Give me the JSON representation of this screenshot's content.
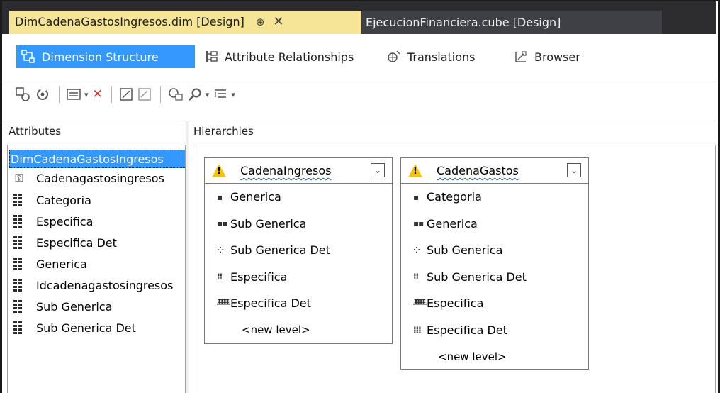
{
  "tabs": {
    "active": "DimCadenaGastosIngresos.dim [Design]",
    "pin_glyph": "⊕",
    "close_glyph": "✕",
    "inactive": "EjecucionFinanciera.cube [Design]"
  },
  "subtabs": {
    "dimension_structure": "Dimension Structure",
    "attribute_relationships": "Attribute Relationships",
    "translations": "Translations",
    "browser": "Browser"
  },
  "panes": {
    "attributes_header": "Attributes",
    "hierarchies_header": "Hierarchies"
  },
  "attributes": {
    "root": "DimCadenaGastosIngresos",
    "items": [
      "Cadenagastosingresos",
      "Categoria",
      "Especifica",
      "Especifica Det",
      "Generica",
      "Idcadenagastosingresos",
      "Sub Generica",
      "Sub Generica Det"
    ]
  },
  "hierarchies": [
    {
      "name": "CadenaIngresos",
      "levels": [
        {
          "dots": "▪",
          "label": "Generica"
        },
        {
          "dots": "▪▪",
          "label": "Sub Generica"
        },
        {
          "dots": "⁘",
          "label": "Sub Generica Det"
        },
        {
          "dots": "⁞⁞",
          "label": "Especifica"
        },
        {
          "dots": "ᚙ",
          "label": "Especifica Det"
        }
      ],
      "new_level": "<new level>"
    },
    {
      "name": "CadenaGastos",
      "levels": [
        {
          "dots": "▪",
          "label": "Categoria"
        },
        {
          "dots": "▪▪",
          "label": "Generica"
        },
        {
          "dots": "⁘",
          "label": "Sub Generica"
        },
        {
          "dots": "⁞⁞",
          "label": "Sub Generica Det"
        },
        {
          "dots": "ᚙ",
          "label": "Especifica"
        },
        {
          "dots": "⁞⁞⁞",
          "label": "Especifica Det"
        }
      ],
      "new_level": "<new level>"
    }
  ],
  "colors": {
    "active_tab": "#f6e596",
    "selection": "#3399ff",
    "warning": "#f5c400"
  }
}
